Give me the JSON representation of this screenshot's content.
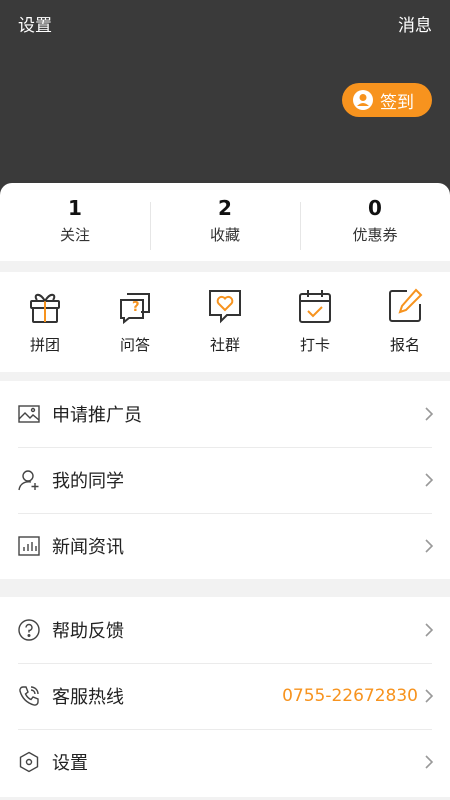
{
  "header": {
    "settings_label": "设置",
    "messages_label": "消息",
    "checkin_label": "签到",
    "accent_color": "#f7931e",
    "background_color": "#3a3a3a"
  },
  "stats": [
    {
      "value": "1",
      "label": "关注"
    },
    {
      "value": "2",
      "label": "收藏"
    },
    {
      "value": "0",
      "label": "优惠券"
    }
  ],
  "quick_actions": [
    {
      "label": "拼团",
      "icon": "gift-icon"
    },
    {
      "label": "问答",
      "icon": "question-chat-icon"
    },
    {
      "label": "社群",
      "icon": "heart-chat-icon"
    },
    {
      "label": "打卡",
      "icon": "calendar-check-icon"
    },
    {
      "label": "报名",
      "icon": "pencil-edit-icon"
    }
  ],
  "menu_group_1": [
    {
      "label": "申请推广员",
      "icon": "image-icon"
    },
    {
      "label": "我的同学",
      "icon": "add-user-icon"
    },
    {
      "label": "新闻资讯",
      "icon": "bar-chart-icon"
    }
  ],
  "menu_group_2": [
    {
      "label": "帮助反馈",
      "icon": "help-circle-icon"
    },
    {
      "label": "客服热线",
      "icon": "phone-icon",
      "value": "0755-22672830"
    },
    {
      "label": "设置",
      "icon": "hexagon-settings-icon"
    }
  ]
}
